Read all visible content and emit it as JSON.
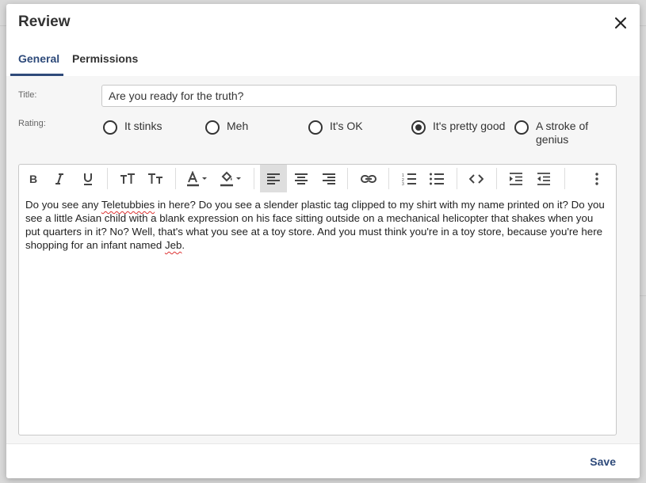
{
  "dialog": {
    "title": "Review"
  },
  "tabs": [
    {
      "label": "General",
      "active": true
    },
    {
      "label": "Permissions",
      "active": false
    }
  ],
  "form": {
    "title_label": "Title:",
    "title_value": "Are you ready for the truth?",
    "rating_label": "Rating:",
    "rating_options": [
      {
        "label": "It stinks",
        "checked": false
      },
      {
        "label": "Meh",
        "checked": false
      },
      {
        "label": "It's OK",
        "checked": false
      },
      {
        "label": "It's pretty good",
        "checked": true
      },
      {
        "label": "A stroke of genius",
        "checked": false
      }
    ]
  },
  "editor": {
    "toolbar_icons": [
      "bold-icon",
      "italic-icon",
      "underline-icon",
      "font-size-increase-icon",
      "font-size-decrease-icon",
      "text-color-icon",
      "highlight-color-icon",
      "align-left-icon",
      "align-center-icon",
      "align-right-icon",
      "link-icon",
      "numbered-list-icon",
      "bullet-list-icon",
      "code-icon",
      "indent-icon",
      "outdent-icon",
      "more-icon"
    ],
    "content": {
      "p1": "Do you see any ",
      "w1": "Teletubbies",
      "p2": " in here? Do you see a slender plastic tag clipped to my shirt with my name printed on it? Do you see a little Asian child with a blank expression on his face sitting outside on a mechanical helicopter that shakes when you put quarters in it? No? Well, that's what you see at a toy store. And you must think you're in a toy store, because you're here shopping for an infant named ",
      "w2": "Jeb",
      "p3": "."
    }
  },
  "footer": {
    "save_label": "Save"
  },
  "colors": {
    "accent": "#2e4a7a",
    "spellcheck": "#d33"
  }
}
